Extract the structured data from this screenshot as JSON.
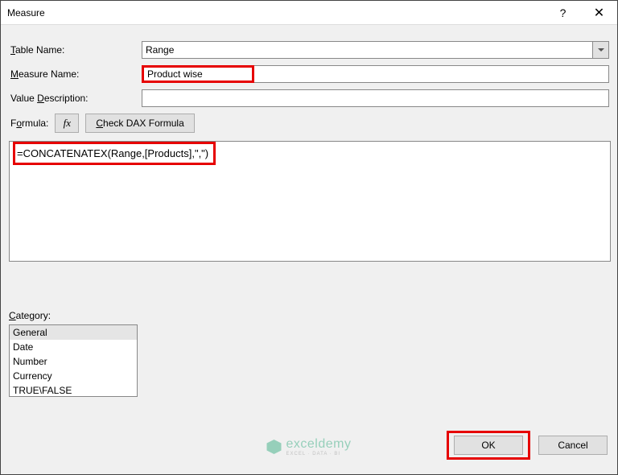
{
  "window": {
    "title": "Measure",
    "help": "?",
    "close": "✕"
  },
  "labels": {
    "table_name_pre": "T",
    "table_name_rest": "able Name:",
    "measure_name_pre": "M",
    "measure_name_rest": "easure Name:",
    "value_desc_pre": "Value ",
    "value_desc_u": "D",
    "value_desc_rest": "escription:",
    "formula_pre": "F",
    "formula_u": "o",
    "formula_rest": "rmula:",
    "category_pre": "C",
    "category_rest": "ategory:"
  },
  "fields": {
    "table_name": "Range",
    "measure_name": "Product wise",
    "value_description": "",
    "formula": "=CONCATENATEX(Range,[Products],\",\")"
  },
  "buttons": {
    "fx": "fx",
    "check_dax_pre": "Check DAX Formula",
    "ok": "OK",
    "cancel": "Cancel"
  },
  "category": {
    "items": [
      "General",
      "Date",
      "Number",
      "Currency",
      "TRUE\\FALSE"
    ],
    "selected_index": 0
  },
  "watermark": {
    "main": "exceldemy",
    "sub": "EXCEL · DATA · BI"
  }
}
